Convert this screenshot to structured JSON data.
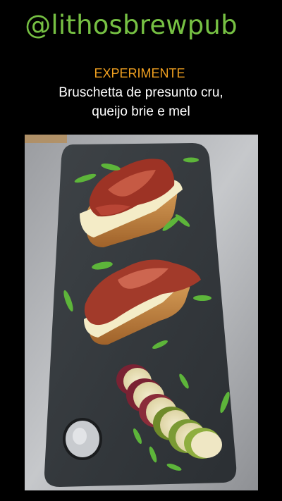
{
  "post": {
    "handle": "@lithosbrewpub",
    "label": "EXPERIMENTE",
    "description_line1": "Bruschetta de presunto cru,",
    "description_line2": "queijo brie e mel"
  },
  "photo": {
    "subject": "food-photo"
  },
  "colors": {
    "handle": "#76c043",
    "label": "#f0a020",
    "description": "#ffffff",
    "background": "#000000"
  }
}
